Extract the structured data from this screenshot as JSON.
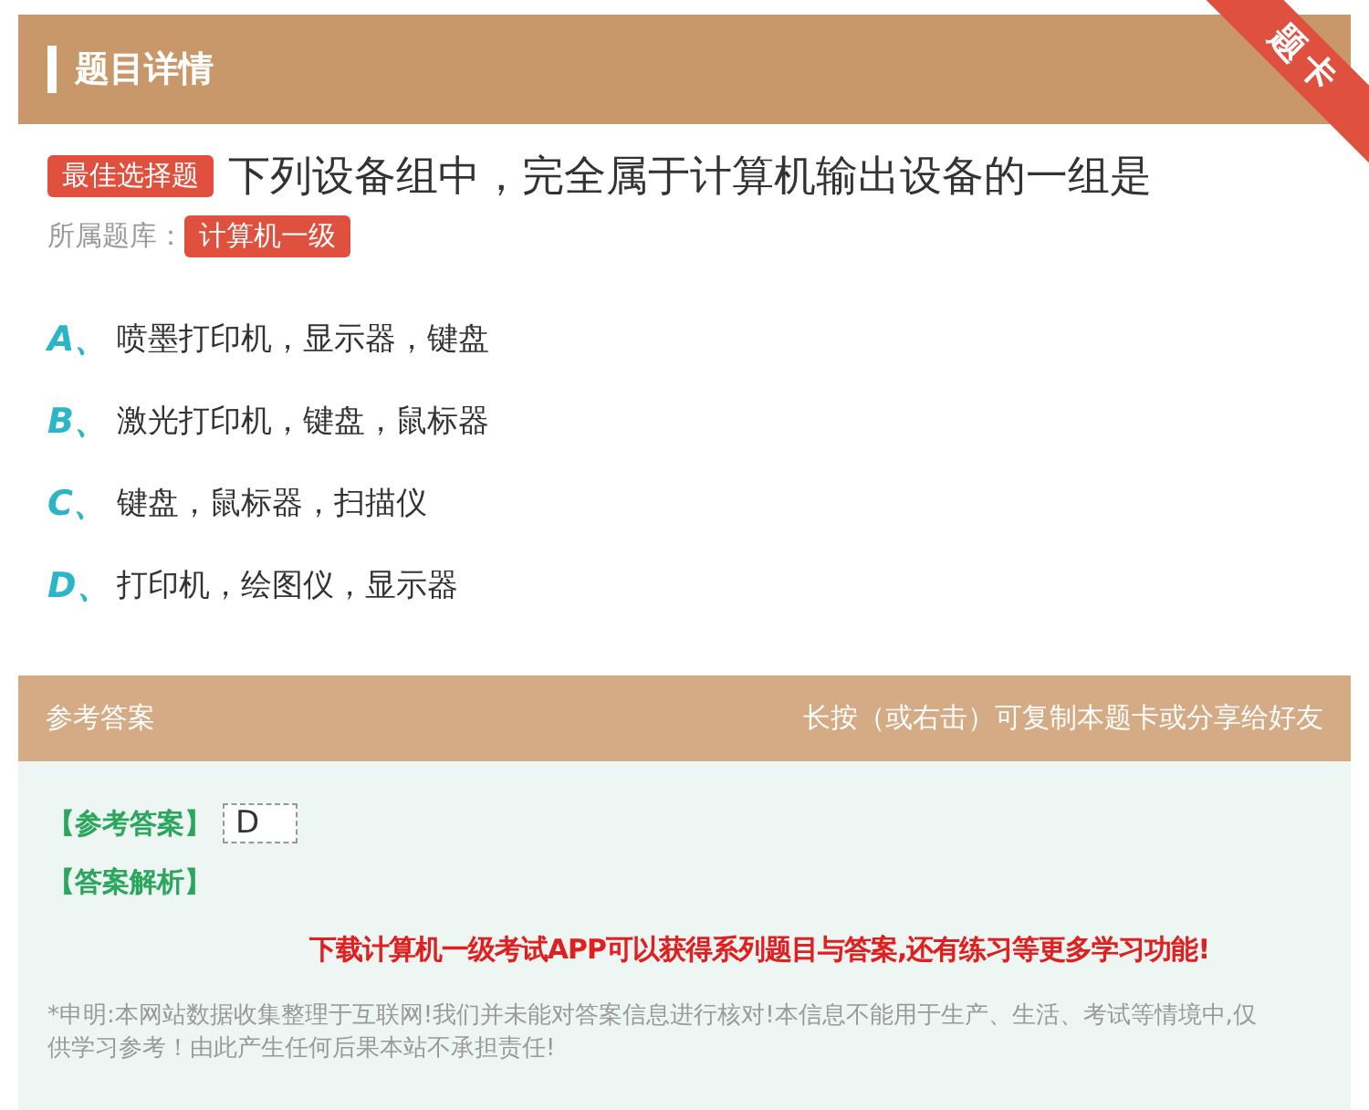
{
  "header": {
    "title": "题目详情",
    "ribbon": "题卡"
  },
  "question": {
    "type_badge": "最佳选择题",
    "text": "下列设备组中，完全属于计算机输出设备的一组是",
    "bank_label": "所属题库：",
    "bank": "计算机一级"
  },
  "options": [
    {
      "letter": "A、",
      "text": "喷墨打印机，显示器，键盘"
    },
    {
      "letter": "B、",
      "text": "激光打印机，键盘，鼠标器"
    },
    {
      "letter": "C、",
      "text": "键盘，鼠标器，扫描仪"
    },
    {
      "letter": "D、",
      "text": "打印机，绘图仪，显示器"
    }
  ],
  "answer_bar": {
    "title": "参考答案",
    "hint": "长按（或右击）可复制本题卡或分享给好友"
  },
  "answer": {
    "answer_label": "【参考答案】",
    "answer_value": "D",
    "analysis_label": "【答案解析】",
    "promo": "下载计算机一级考试APP可以获得系列题目与答案,还有练习等更多学习功能!",
    "disclaimer": "*申明:本网站数据收集整理于互联网!我们并未能对答案信息进行核对!本信息不能用于生产、生活、考试等情境中,仅供学习参考！由此产生任何后果本站不承担责任!"
  }
}
